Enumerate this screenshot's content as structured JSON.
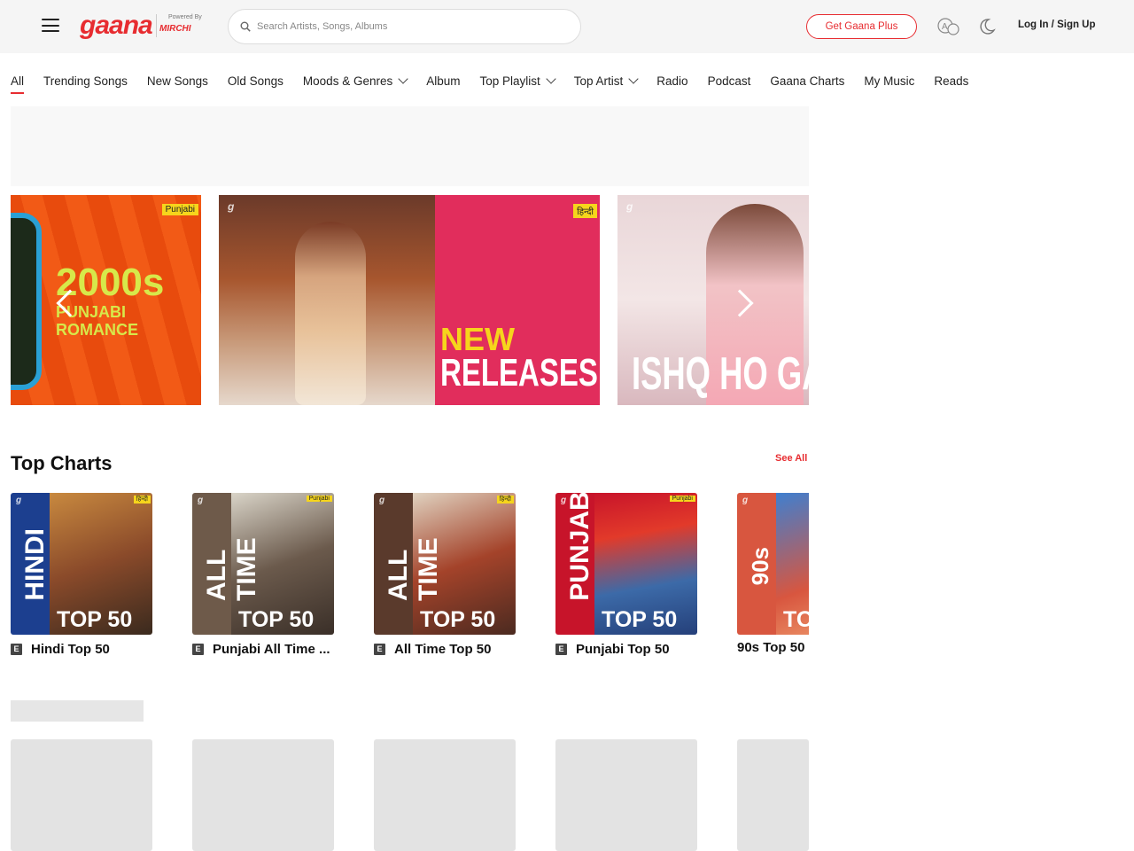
{
  "header": {
    "logo_text": "gaana",
    "powered_by": "Powered By",
    "partner": "MIRCHI",
    "search_placeholder": "Search Artists, Songs, Albums",
    "cta_label": "Get Gaana Plus",
    "login_label": "Log In / Sign Up",
    "accent_color": "#e72c30"
  },
  "nav": {
    "items": [
      {
        "label": "All",
        "active": true
      },
      {
        "label": "Trending Songs"
      },
      {
        "label": "New Songs"
      },
      {
        "label": "Old Songs"
      },
      {
        "label": "Moods & Genres",
        "dropdown": true
      },
      {
        "label": "Album"
      },
      {
        "label": "Top Playlist",
        "dropdown": true
      },
      {
        "label": "Top Artist",
        "dropdown": true
      },
      {
        "label": "Radio"
      },
      {
        "label": "Podcast"
      },
      {
        "label": "Gaana Charts"
      },
      {
        "label": "My Music"
      },
      {
        "label": "Reads"
      }
    ]
  },
  "carousel": {
    "slides": [
      {
        "tag": "Punjabi",
        "title": "2000s",
        "subtitle_line1": "PUNJABI",
        "subtitle_line2": "ROMANCE"
      },
      {
        "tag": "हिन्दी",
        "title": "NEW",
        "subtitle": "RELEASES"
      },
      {
        "title": "ISHQ HO GAY"
      }
    ]
  },
  "top_charts": {
    "title": "Top Charts",
    "see_all": "See All",
    "cards": [
      {
        "vertical_text": "HINDI",
        "bottom_text": "TOP 50",
        "tag": "हिन्दी",
        "label": "Hindi Top 50",
        "explicit": "E",
        "band_color": "#1c3f8f"
      },
      {
        "vertical_text": "ALL TIME",
        "bottom_text": "TOP 50",
        "tag": "Punjabi",
        "label": "Punjabi All Time ...",
        "explicit": "E",
        "band_color": "#6e5a4a"
      },
      {
        "vertical_text": "ALL TIME",
        "bottom_text": "TOP 50",
        "tag": "हिन्दी",
        "label": "All Time Top 50",
        "explicit": "E",
        "band_color": "#5a3a2c"
      },
      {
        "vertical_text": "PUNJABI",
        "bottom_text": "TOP 50",
        "tag": "Punjabi",
        "label": "Punjabi Top 50",
        "explicit": "E",
        "band_color": "#c7142a"
      },
      {
        "vertical_text": "90s",
        "bottom_text": "TO",
        "label": "90s Top 50",
        "band_color": "#d8563f"
      }
    ]
  }
}
